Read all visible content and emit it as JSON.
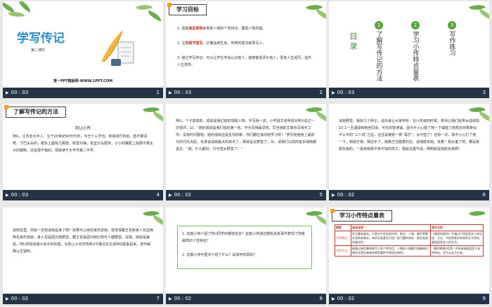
{
  "slides": [
    {
      "num": "1",
      "time": "00 : 03",
      "title": "学写传记",
      "subtitle": "第二课时",
      "footer": "第一PPT模板网-WWW.1PPT.COM"
    },
    {
      "num": "2",
      "time": "00 : 03",
      "title": "学习目标",
      "item1": {
        "pre": "1. 选取",
        "hl": "典型事例",
        "post": "来表现人物的个性特点，展现人物风貌。"
      },
      "item2": {
        "pre": "2. 注重",
        "hl": "细节描写",
        "post": "，正确运用生动、传神的笔法叙事写人。"
      },
      "item3": "3. 通过学写传记，可以让学生学会认识他人，能够客观评价他人，思考人生经历，提升人生境界。"
    },
    {
      "num": "3",
      "time": "00 : 03",
      "title": "目录",
      "sections": [
        {
          "n": "1",
          "text": "了解写传记的方法"
        },
        {
          "n": "2",
          "text": "学习小传特点量表"
        },
        {
          "n": "3",
          "text": "写作练习"
        }
      ]
    },
    {
      "num": "4",
      "time": "00 : 03",
      "title": "了解写传记的方法",
      "heading": "阿U小传",
      "text": "阿U，江苏省大丰人，生于20世纪90年代末，今已十三岁也。身高四尺有余，脸不算清秀，下巴尖尖的，眼永上圆有几颗痣，皎冒刘海，发型为马尾辫，小小的嘴配上她那不算太大的眼睛，还是很不错的。现就读于大丰市第二中学。"
    },
    {
      "num": "5",
      "time": "00 : 02",
      "text": "阿U，个子高高的，成绩是我们班的领航人物，字写得一流，小学语文老师曾对阿U说过一次很评，曰：“她的成绩是我们班的第一名，字也写得最漂亮，同当她的文章也写得字工作，没有时间警她，她的成绩还是名列前茅，你们都应该向她学习呀！”罗列完她身上最别光的闪光点后，也该谈谈她最大的缺点了，那就是太野蛮了。对，请我们以前的班长得她都说过：“她，什么都好，只可惜太野蛮了！”"
    },
    {
      "num": "6",
      "time": "00 : 02",
      "text": "说她野蛮，我有几个例子，说出来让大家听听：在六年级的时候，老师让我们班男女成绩前10.1一旦遇成和她坐同桌，可怜的智通诚。因为不小心碰了她一下或越了她规定的那条似不公平的“三八线”之后，往往是被她一顿“毒打”，太可怕了！还有一次，我不小心打了她一下，她就打我。我还手了，她跳王住握着的拉，说他欺负她，夹着！我太鬼了吧，哪是我欺负她的，一看到她那不依不饶的样子，我就没勇气说，明明就是她欺负我啊！"
    },
    {
      "num": "7",
      "time": "00 : 02",
      "text": "说到这里，你就一定知道她是谁了吧？如果可以用花来形容她，我觉得霸王花和食人花这两种花来形容她，食人花是因为她野蛮，霸王花是因为她比较可人都野蛮。没错，她就是美姑，阿U阅安尚姐大名中的豹兽。为防止大先伤将阿U与鲁迅先生的阿Q联系起来，遂作解释以正视听。"
    },
    {
      "num": "8",
      "time": "00 : 02",
      "q1": "1. 这篇小传介绍了阿U同学的哪些信息？这篇小传通过哪些具体事件表现了阿柔最样的个性特征？",
      "q2": "2. 这篇小传中重点介绍了什么？是如何实现的？"
    },
    {
      "num": "9",
      "time": "00 : 02",
      "title": "学习小传特点量表",
      "headers": [
        "要素",
        "具体体现",
        "课文分析"
      ],
      "rows": [
        {
          "k": "写作特点",
          "v": "传记要有真实。只是文中涉及的时间、地点、人物、事件等都必须具体真实，有时记录甚至引用一些可靠的资料，保证叙述的真实性。",
          "c": "《美丽的颜色》中通过引用居里夫人的论述，日记、书信等真实有效的文字资料，展现居里夫人的生活。"
        },
        {
          "k": "写作方法",
          "v": "能通过典型事例来写人的个性特点。人物的人格魅力和精神风貌往往是在具体的典型事件中表现出来的。",
          "c": "《穆罕默德·阿里》中作者借助居里大米的举动。学生从这几位来。"
        }
      ]
    }
  ]
}
